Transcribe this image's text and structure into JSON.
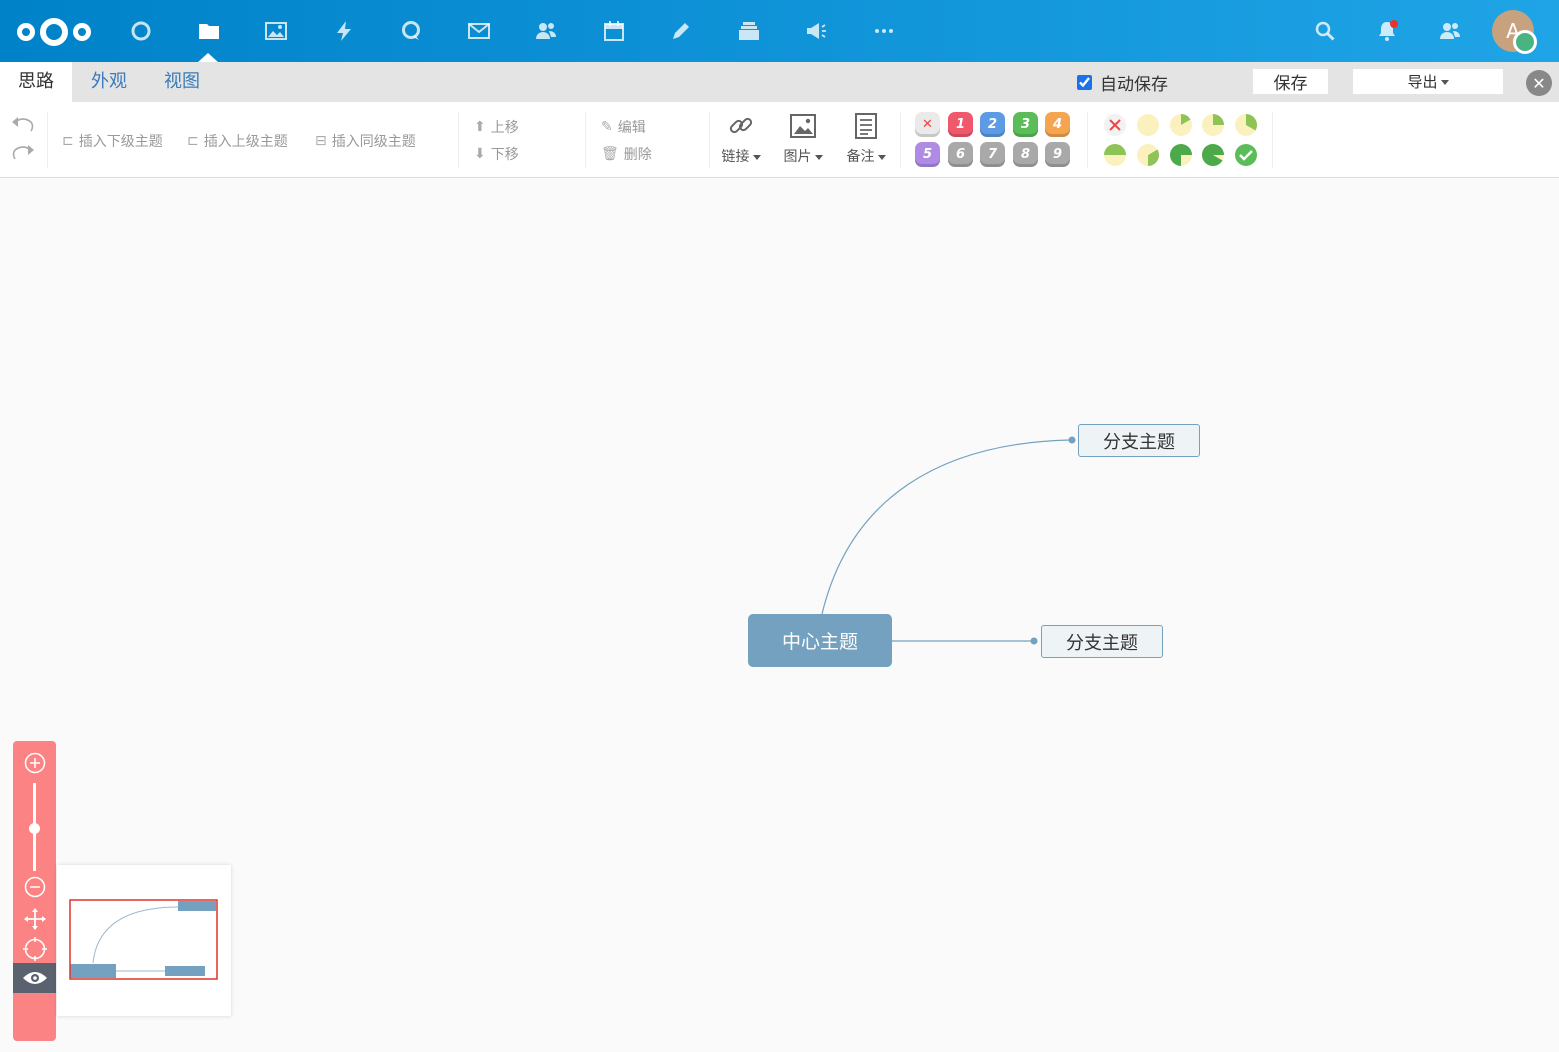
{
  "topbar": {
    "apps": [
      "dashboard-icon",
      "files-icon",
      "photos-icon",
      "activity-icon",
      "talk-icon",
      "mail-icon",
      "contacts-icon",
      "calendar-icon",
      "notes-icon",
      "deck-icon",
      "announcements-icon",
      "more-icon"
    ],
    "active_app": "files-icon",
    "avatar_letter": "A"
  },
  "menu": {
    "tabs": [
      "思路",
      "外观",
      "视图"
    ],
    "autosave_label": "自动保存",
    "save_label": "保存",
    "export_label": "导出"
  },
  "toolbar": {
    "insert_child": "插入下级主题",
    "insert_parent": "插入上级主题",
    "insert_sibling": "插入同级主题",
    "move_up": "上移",
    "move_down": "下移",
    "edit": "编辑",
    "delete": "删除",
    "link": "链接",
    "image": "图片",
    "note": "备注",
    "priorities": [
      "1",
      "2",
      "3",
      "4",
      "5",
      "6",
      "7",
      "8",
      "9"
    ]
  },
  "mindmap": {
    "root": "中心主题",
    "branches": [
      "分支主题",
      "分支主题"
    ]
  },
  "colors": {
    "nav_gradient_start": "#0082c9",
    "nav_gradient_end": "#1fa4e6",
    "node_root": "#73a1bf",
    "zoom_panel": "#fc8383"
  }
}
